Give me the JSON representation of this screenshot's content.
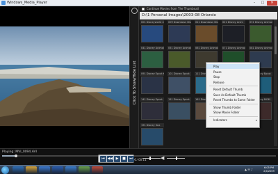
{
  "window": {
    "title": "Windows_Media_Player",
    "min_glyph": "–",
    "max_glyph": "□",
    "close_glyph": "✕"
  },
  "video_toggle": {
    "label": "Click To Show/Hide List"
  },
  "panel": {
    "continue_label": "Continue Movies from The Thumbnail",
    "path": "D:\\1 Personal Images\\2003-08 Orlando"
  },
  "thumbnails": [
    {
      "caption": "001 Disneyworld 4",
      "color": "#274a7e"
    },
    {
      "caption": "009 Downtown Dis",
      "color": "#2d3a55"
    },
    {
      "caption": "011 Downtown Dis",
      "color": "#6a4c2b"
    },
    {
      "caption": "021 Disney Anim",
      "color": "#1d1f26"
    },
    {
      "caption": "031 Disney Animal",
      "color": "#3b5a2e"
    },
    {
      "caption": "041 Disney Animal",
      "color": "#2c5f41"
    },
    {
      "caption": "051 Disney Animal",
      "color": "#4a5a2a"
    },
    {
      "caption": "061 Disney Animal",
      "color": "#3e3a2f"
    },
    {
      "caption": "071 Disney Animal",
      "color": "#1f4e2a"
    },
    {
      "caption": "081 Disney Animal",
      "color": "#2e3b4f"
    },
    {
      "caption": "091 Disney Epcot K",
      "color": "#2a3346"
    },
    {
      "caption": "101 Disney Epcot",
      "color": "#3f5066"
    },
    {
      "caption": "111 Disney Epcot",
      "color": "#2b6b8a"
    },
    {
      "caption": "121 Disney Epcot",
      "color": "#1a2b57"
    },
    {
      "caption": "131 Disney Epcot",
      "color": "#1e5d7a"
    },
    {
      "caption": "141 Disney Epcot",
      "color": "#2e2e3a"
    },
    {
      "caption": "151 Disney Epcot",
      "color": "#3a4f62"
    },
    {
      "caption": "161 Disney MGM",
      "color": "#5a4a3e"
    },
    {
      "caption": "171 Disney MGM",
      "color": "#2a2a2a"
    },
    {
      "caption": "181 Disney MGM",
      "color": "#3d2a2a"
    },
    {
      "caption": "191 Disney Sea",
      "color": "#274b6a"
    }
  ],
  "context_menu": [
    {
      "label": "Play",
      "highlight": true
    },
    {
      "label": "Pause"
    },
    {
      "label": "Stop"
    },
    {
      "label": "Release"
    },
    {
      "sep": true
    },
    {
      "label": "Reset Default Thumb"
    },
    {
      "label": "Save As Default Thumb"
    },
    {
      "label": "Reset Thumbs to Same Folder"
    },
    {
      "sep": true
    },
    {
      "label": "Show Thumb Folder"
    },
    {
      "label": "Show Movie Folder"
    },
    {
      "sep": true
    },
    {
      "label": "Indicators",
      "submenu": true
    }
  ],
  "status": {
    "playing": "Playing: MVI_0094.AVI",
    "progress": 0.05,
    "speed_text": "1.00   ⁄ 00:11"
  },
  "controls": {
    "prev": "⏮",
    "rew": "◀◀",
    "play": "▶",
    "stop": "■",
    "next": "⏭"
  },
  "volume": {
    "icon": "◀",
    "level": 0.4
  },
  "speed": {
    "level": 0.5
  },
  "taskbar": {
    "clock_time": "6:05 PM",
    "clock_date": "2/4/2009",
    "tray_icons": "▲ ✉ ♪",
    "items": [
      {
        "name": "ie",
        "color": "#2f6fb8"
      },
      {
        "name": "explorer",
        "color": "#d9a53a"
      },
      {
        "name": "mediaplayer",
        "color": "#3b7ad1"
      },
      {
        "name": "word",
        "color": "#2a5db0"
      },
      {
        "name": "outlook",
        "color": "#3a7fd0"
      },
      {
        "name": "app6",
        "color": "#6aa14a"
      },
      {
        "name": "app7",
        "color": "#c14a3a"
      }
    ]
  }
}
